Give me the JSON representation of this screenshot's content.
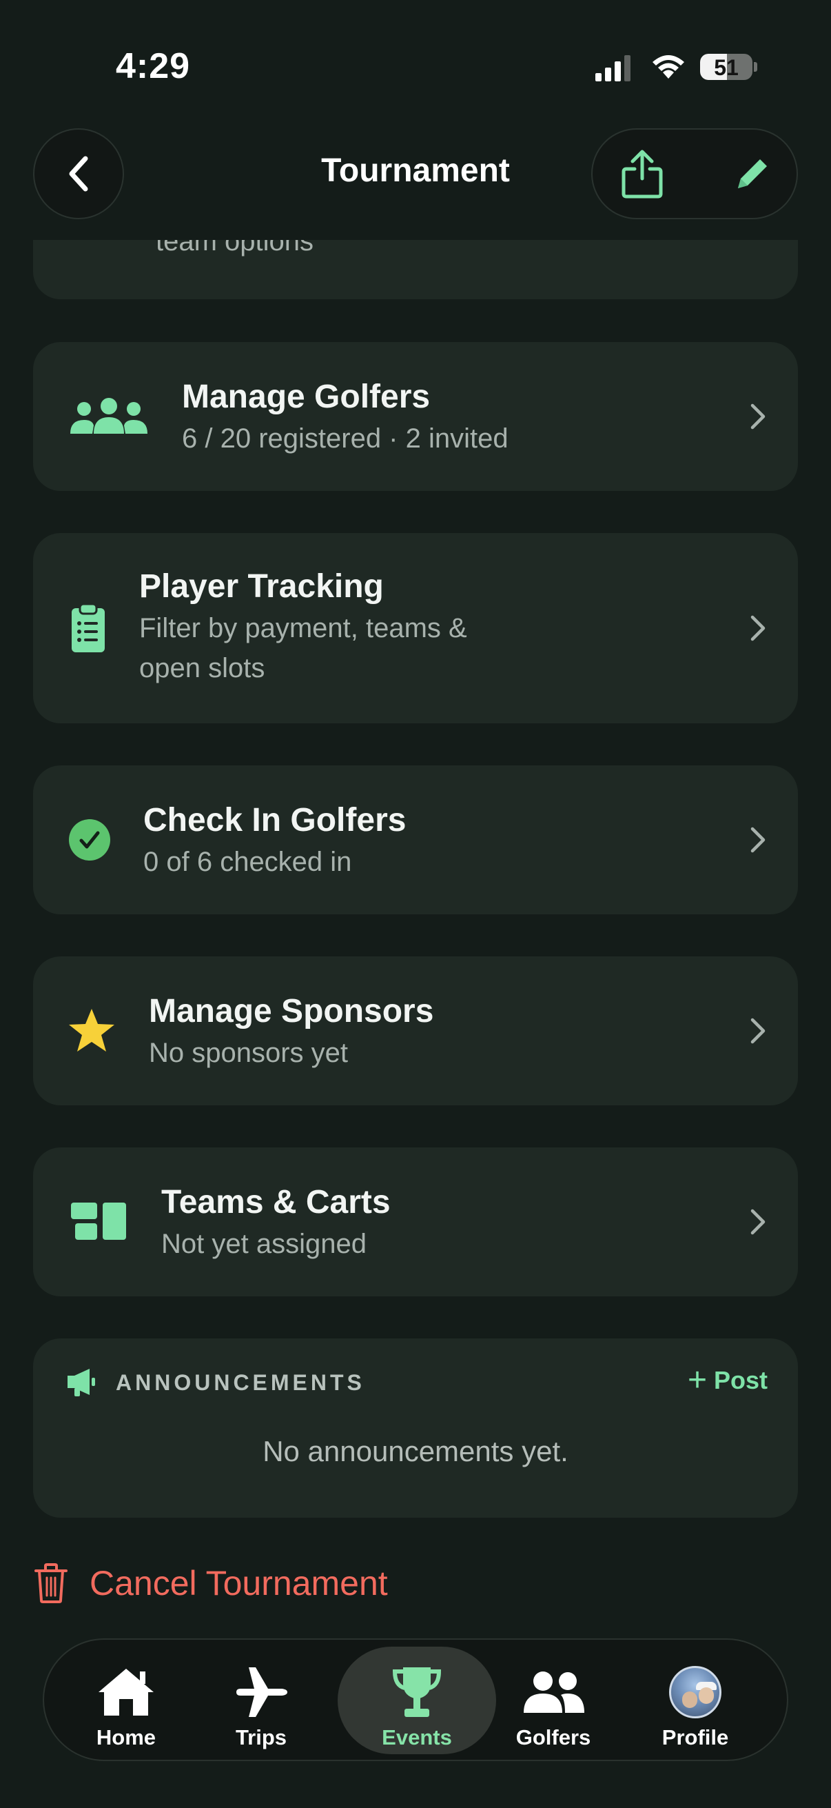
{
  "status_bar": {
    "time": "4:29",
    "battery": "51",
    "battery_level": 0.51
  },
  "nav": {
    "title": "Tournament"
  },
  "partial_card": {
    "subtitle": "team options"
  },
  "cards": {
    "manage_golfers": {
      "title": "Manage Golfers",
      "subtitle": "6 / 20 registered · 2 invited",
      "icon": "users-icon"
    },
    "player_tracking": {
      "title": "Player Tracking",
      "subtitle_line1": "Filter by payment, teams &",
      "subtitle_line2": "open slots",
      "icon": "clipboard-list-icon"
    },
    "check_in": {
      "title": "Check In Golfers",
      "subtitle": "0 of 6 checked in",
      "icon": "check-circle-icon"
    },
    "sponsors": {
      "title": "Manage Sponsors",
      "subtitle": "No sponsors yet",
      "icon": "star-icon"
    },
    "teams_carts": {
      "title": "Teams & Carts",
      "subtitle": "Not yet assigned",
      "icon": "layout-grid-icon"
    }
  },
  "announcements": {
    "label": "ANNOUNCEMENTS",
    "post_label": "Post",
    "empty_text": "No announcements yet."
  },
  "cancel": {
    "label": "Cancel Tournament"
  },
  "tabs": [
    {
      "label": "Home",
      "icon": "house-icon",
      "active": false
    },
    {
      "label": "Trips",
      "icon": "airplane-icon",
      "active": false
    },
    {
      "label": "Events",
      "icon": "trophy-icon",
      "active": true
    },
    {
      "label": "Golfers",
      "icon": "users-icon",
      "active": false
    },
    {
      "label": "Profile",
      "icon": "avatar",
      "active": false
    }
  ],
  "colors": {
    "background": "#141c19",
    "card": "#1f2924",
    "accent_green": "#7ee2a8",
    "check_green": "#5cc46e",
    "star_yellow": "#f7d139",
    "danger_red": "#f26b5e"
  }
}
